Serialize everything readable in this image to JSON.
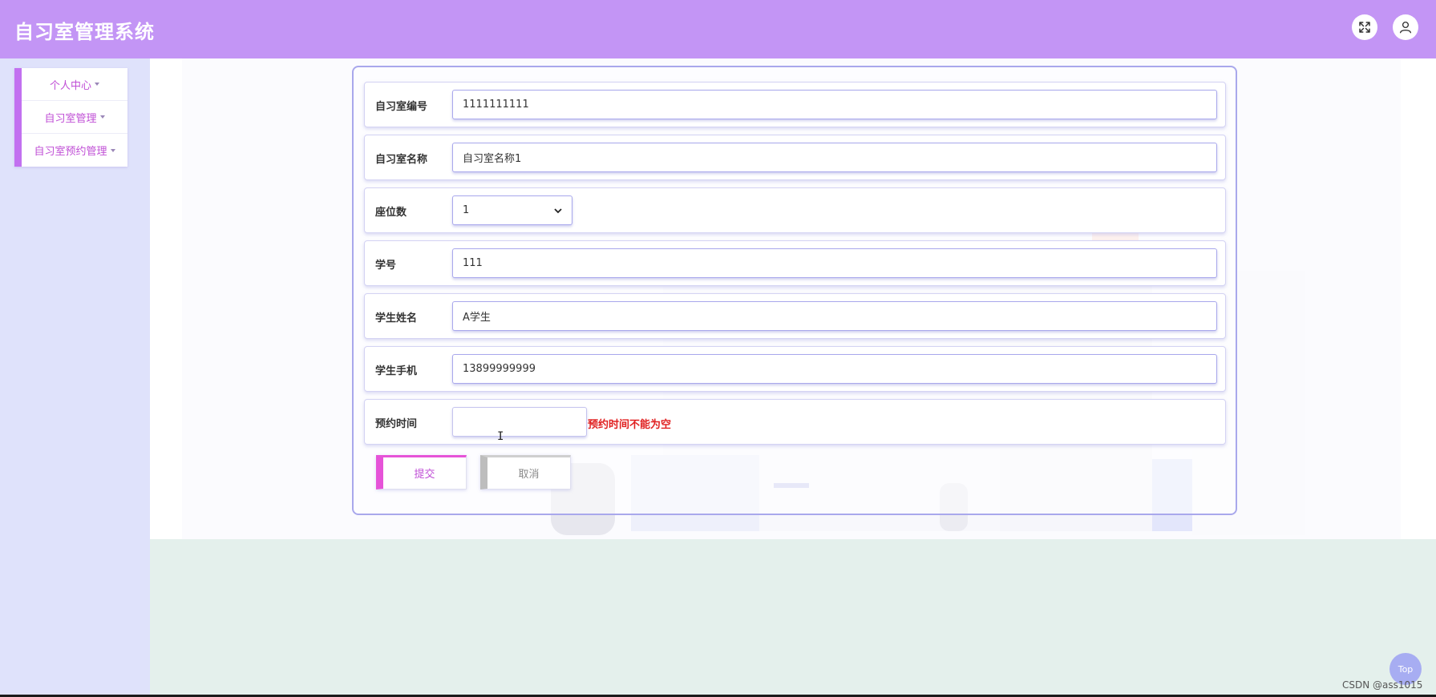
{
  "header": {
    "app_title": "自习室管理系统",
    "fullscreen_icon": "expand-icon",
    "user_icon": "user-icon"
  },
  "sidebar": {
    "items": [
      {
        "label": "个人中心"
      },
      {
        "label": "自习室管理"
      },
      {
        "label": "自习室预约管理"
      }
    ]
  },
  "form": {
    "fields": [
      {
        "label": "自习室编号",
        "value": "1111111111"
      },
      {
        "label": "自习室名称",
        "value": "自习室名称1"
      },
      {
        "label": "座位数",
        "value": "1"
      },
      {
        "label": "学号",
        "value": "111"
      },
      {
        "label": "学生姓名",
        "value": "A学生"
      },
      {
        "label": "学生手机",
        "value": "13899999999"
      },
      {
        "label": "预约时间",
        "value": "",
        "error": "预约时间不能为空"
      }
    ],
    "submit_label": "提交",
    "cancel_label": "取消"
  },
  "back_to_top": "Top",
  "watermark": "CSDN @ass1015",
  "colors": {
    "header_bg": "#c395f5",
    "sidebar_bg": "#dfe2fb",
    "accent": "#c270f0",
    "error": "#e01f1f"
  }
}
